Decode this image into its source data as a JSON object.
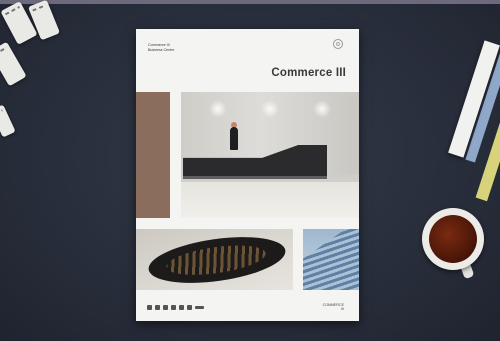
{
  "brochure": {
    "header_line1": "Commerce III",
    "header_line2": "Business Centre",
    "title": "Commerce III",
    "footer_line1": "COMMERCE",
    "footer_line2": "III"
  }
}
